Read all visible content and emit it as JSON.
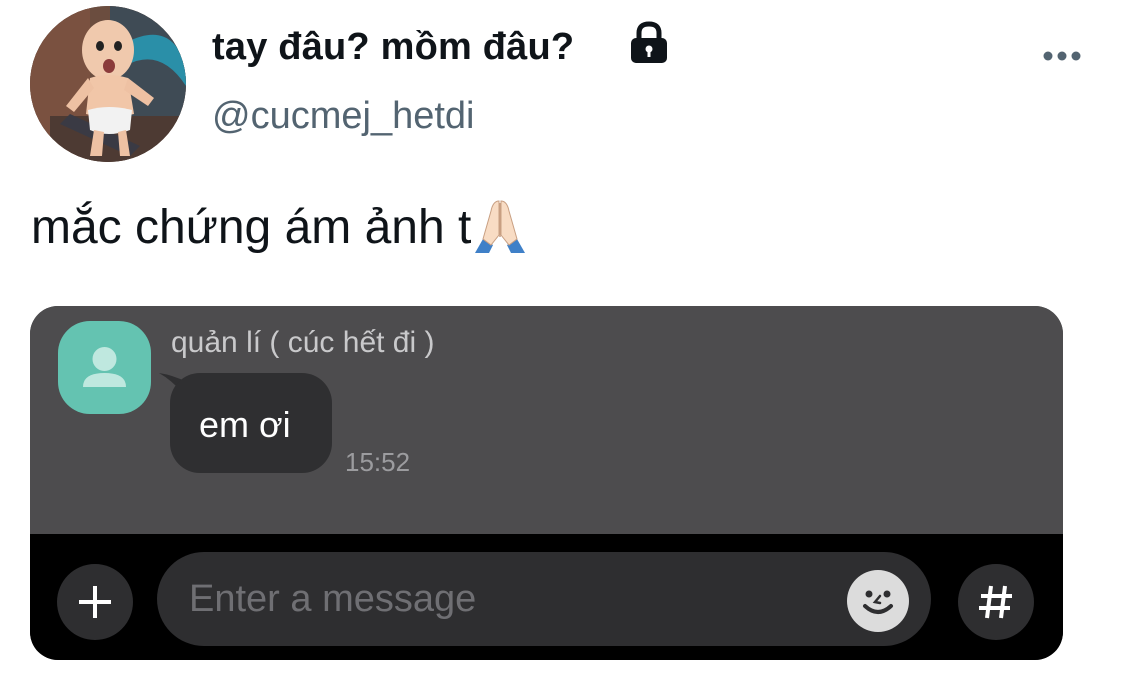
{
  "tweet": {
    "display_name": "tay đâu? mồm đâu?",
    "handle": "@cucmej_hetdi",
    "text": "mắc chứng ám ảnh t",
    "icons": {
      "avatar": "baby-avatar",
      "lock": "lock-icon",
      "more": "more-options-icon",
      "emoji": "folded-hands-emoji"
    }
  },
  "embedded_chat": {
    "contact_name": "quản lí ( cúc hết đi )",
    "message": {
      "text": "em ơi",
      "time": "15:52"
    },
    "input": {
      "placeholder": "Enter a message"
    },
    "icons": {
      "contact_avatar": "person-icon",
      "add": "plus-icon",
      "emoji": "smiley-icon",
      "hashtag": "hash-icon"
    },
    "colors": {
      "chat_background": "#4d4c4e",
      "bubble": "#2f2f31",
      "input_bar": "#000000",
      "contact_avatar": "#64c3b1"
    }
  }
}
